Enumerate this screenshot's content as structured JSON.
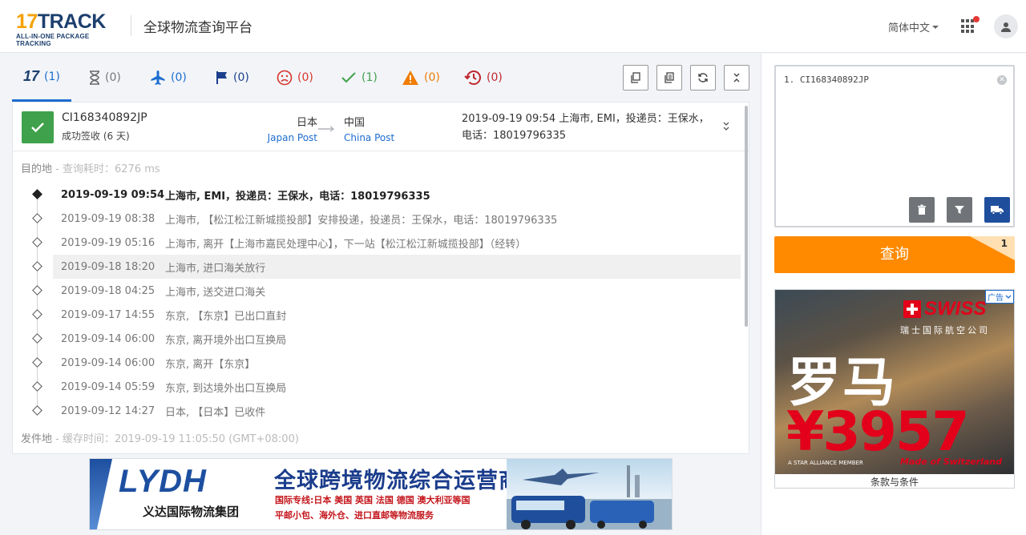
{
  "header": {
    "logo_main_17": "17",
    "logo_main_track": "TRACK",
    "logo_sub": "ALL-IN-ONE PACKAGE TRACKING",
    "platform_title": "全球物流查询平台",
    "language": "简体中文",
    "apps_icon": "grid-icon",
    "avatar_icon": "user-icon"
  },
  "tabs": [
    {
      "icon": "17track-icon",
      "count": "(1)",
      "color": "#1c6dd0"
    },
    {
      "icon": "hourglass-icon",
      "count": "(0)",
      "color": "#777777"
    },
    {
      "icon": "airplane-icon",
      "count": "(0)",
      "color": "#1c6dd0"
    },
    {
      "icon": "flag-icon",
      "count": "(0)",
      "color": "#1c3f8c"
    },
    {
      "icon": "sad-face-icon",
      "count": "(0)",
      "color": "#d9352b"
    },
    {
      "icon": "check-icon",
      "count": "(1)",
      "color": "#3fa14b"
    },
    {
      "icon": "warning-icon",
      "count": "(0)",
      "color": "#f07c00"
    },
    {
      "icon": "history-icon",
      "count": "(0)",
      "color": "#c0272d"
    }
  ],
  "toolbar": [
    "copy-icon",
    "copy-all-icon",
    "refresh-icon",
    "collapse-all-icon"
  ],
  "shipment": {
    "tracking_number": "CI168340892JP",
    "status": "成功签收 (6 天)",
    "origin_country": "日本",
    "origin_carrier": "Japan Post",
    "dest_country": "中国",
    "dest_carrier": "China Post",
    "latest_event": "2019-09-19 09:54 上海市, EMI，投递员：王保水，电话：18019796335",
    "destination_label": "目的地",
    "destination_meta": "- 查询耗时：6276 ms",
    "origin_label": "发件地",
    "origin_meta": "- 缓存时间：2019-09-19 11:05:50 (GMT+08:00)"
  },
  "events": [
    {
      "time": "2019-09-19 09:54",
      "desc": "上海市, EMI，投递员：王保水，电话：18019796335"
    },
    {
      "time": "2019-09-19 08:38",
      "desc": "上海市, 【松江松江新城揽投部】安排投递，投递员：王保水，电话：18019796335"
    },
    {
      "time": "2019-09-19 05:16",
      "desc": "上海市, 离开【上海市嘉民处理中心】，下一站【松江松江新城揽投部】（经转）"
    },
    {
      "time": "2019-09-18 18:20",
      "desc": "上海市, 进口海关放行"
    },
    {
      "time": "2019-09-18 04:25",
      "desc": "上海市, 送交进口海关"
    },
    {
      "time": "2019-09-17 14:55",
      "desc": "东京, 【东京】已出口直封"
    },
    {
      "time": "2019-09-14 06:00",
      "desc": "东京, 离开境外出口互换局"
    },
    {
      "time": "2019-09-14 06:00",
      "desc": "东京, 离开【东京】"
    },
    {
      "time": "2019-09-14 05:59",
      "desc": "东京, 到达境外出口互换局"
    },
    {
      "time": "2019-09-12 14:27",
      "desc": "日本, 【日本】已收件"
    }
  ],
  "right": {
    "input_value": "1. CI168340892JP",
    "query_label": "查询",
    "query_count": "1",
    "ad_tag": "广告",
    "ad_brand": "SWISS",
    "ad_brand_cn": "瑞士国际航空公司",
    "ad_city": "罗马",
    "ad_price": "¥3957",
    "ad_alliance": "A STAR ALLIANCE MEMBER",
    "ad_made": "Made of Switzerland",
    "ad_terms": "条款与条件"
  },
  "banner": {
    "logo": "LYDH",
    "group_name": "义达国际物流集团",
    "slogan": "全球跨境物流综合运营商",
    "line1": "国际专线:日本 美国 英国 法国 德国 澳大利亚等国",
    "line2": "平邮小包、海外仓、进口直邮等物流服务"
  },
  "colors": {
    "accent": "#1c6dd0",
    "success": "#3fa14b",
    "query": "#ff8a00",
    "brand_navy": "#1c3f6e"
  }
}
